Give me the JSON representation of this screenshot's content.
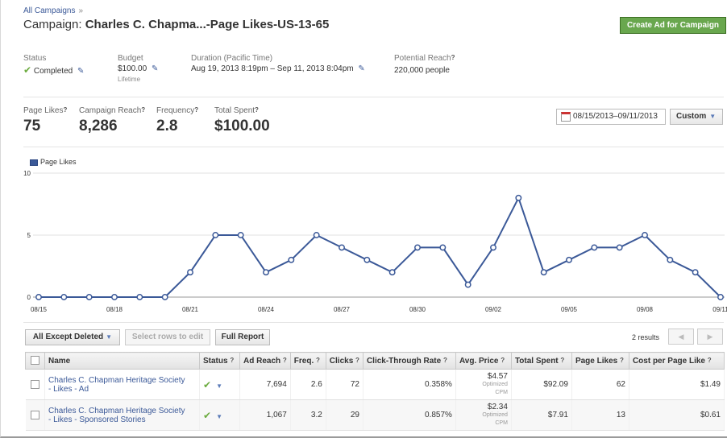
{
  "breadcrumb": {
    "link": "All Campaigns",
    "sep": "»"
  },
  "campaign": {
    "prefix": "Campaign:",
    "name": "Charles C. Chapma...-Page Likes-US-13-65"
  },
  "create_button": "Create Ad for Campaign",
  "info": {
    "status_label": "Status",
    "status_value": "Completed",
    "budget_label": "Budget",
    "budget_value": "$100.00",
    "budget_sub": "Lifetime",
    "duration_label": "Duration (Pacific Time)",
    "duration_value": "Aug 19, 2013 8:19pm – Sep 11, 2013 8:04pm",
    "reach_label": "Potential Reach",
    "reach_value": "220,000 people"
  },
  "stats": {
    "page_likes_label": "Page Likes",
    "page_likes": "75",
    "campaign_reach_label": "Campaign Reach",
    "campaign_reach": "8,286",
    "frequency_label": "Frequency",
    "frequency": "2.8",
    "total_spent_label": "Total Spent",
    "total_spent": "$100.00"
  },
  "date_range": "08/15/2013–09/11/2013",
  "custom_label": "Custom",
  "chart_data": {
    "type": "line",
    "legend": "Page Likes",
    "ylim": [
      0,
      10
    ],
    "y_ticks": [
      "0",
      "5",
      "10"
    ],
    "x_tick_labels": [
      "08/15",
      "08/18",
      "08/21",
      "08/24",
      "08/27",
      "08/30",
      "09/02",
      "09/05",
      "09/08",
      "09/11"
    ],
    "x": [
      "08/15",
      "08/16",
      "08/17",
      "08/18",
      "08/19",
      "08/20",
      "08/21",
      "08/22",
      "08/23",
      "08/24",
      "08/25",
      "08/26",
      "08/27",
      "08/28",
      "08/29",
      "08/30",
      "08/31",
      "09/01",
      "09/02",
      "09/03",
      "09/04",
      "09/05",
      "09/06",
      "09/07",
      "09/08",
      "09/09",
      "09/10",
      "09/11"
    ],
    "series": [
      {
        "name": "Page Likes",
        "values": [
          0,
          0,
          0,
          0,
          0,
          0,
          2,
          5,
          5,
          2,
          3,
          5,
          4,
          3,
          2,
          4,
          4,
          1,
          4,
          8,
          2,
          3,
          4,
          4,
          5,
          3,
          2,
          0
        ]
      }
    ],
    "line_color": "#3b5998",
    "grid": true
  },
  "toolbar": {
    "filter": "All Except Deleted",
    "edit": "Select rows to edit",
    "report": "Full Report",
    "results": "2 results",
    "prev": "◀",
    "next": "▶"
  },
  "table": {
    "headers": [
      "Name",
      "Status",
      "Ad Reach",
      "Freq.",
      "Clicks",
      "Click-Through Rate",
      "Avg. Price",
      "Total Spent",
      "Page Likes",
      "Cost per Page Like"
    ],
    "rows": [
      {
        "name1": "Charles C. Chapman Heritage Society",
        "name2": "- Likes - Ad",
        "reach": "7,694",
        "freq": "2.6",
        "clicks": "72",
        "ctr": "0.358%",
        "price": "$4.57",
        "price_sub1": "Optimized",
        "price_sub2": "CPM",
        "spent": "$92.09",
        "likes": "62",
        "cpl": "$1.49"
      },
      {
        "name1": "Charles C. Chapman Heritage Society",
        "name2": "- Likes - Sponsored Stories",
        "reach": "1,067",
        "freq": "3.2",
        "clicks": "29",
        "ctr": "0.857%",
        "price": "$2.34",
        "price_sub1": "Optimized",
        "price_sub2": "CPM",
        "spent": "$7.91",
        "likes": "13",
        "cpl": "$0.61"
      }
    ]
  }
}
